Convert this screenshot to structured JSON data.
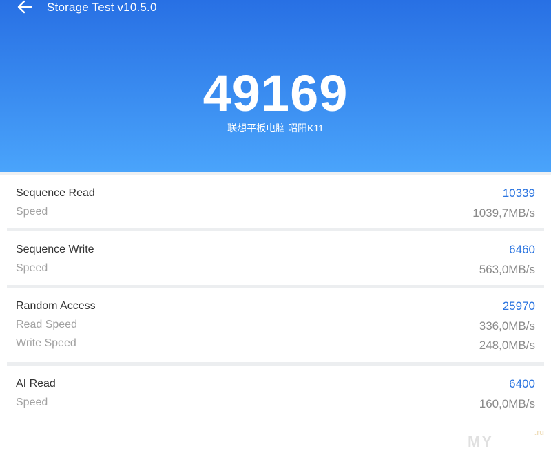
{
  "header": {
    "back_icon": "arrow-left-icon",
    "title": "Storage Test v10.5.0",
    "total_score": "49169",
    "device": "联想平板电脑 昭阳K11"
  },
  "results": [
    {
      "name": "Sequence Read",
      "score": "10339",
      "metrics": [
        {
          "label": "Speed",
          "value": "1039,7MB/s"
        }
      ]
    },
    {
      "name": "Sequence Write",
      "score": "6460",
      "metrics": [
        {
          "label": "Speed",
          "value": "563,0MB/s"
        }
      ]
    },
    {
      "name": "Random Access",
      "score": "25970",
      "metrics": [
        {
          "label": "Read Speed",
          "value": "336,0MB/s"
        },
        {
          "label": "Write Speed",
          "value": "248,0MB/s"
        }
      ]
    },
    {
      "name": "AI Read",
      "score": "6400",
      "metrics": [
        {
          "label": "Speed",
          "value": "160,0MB/s"
        }
      ]
    }
  ],
  "watermark": {
    "text": "MY",
    "sup": ".ru"
  },
  "colors": {
    "header_top": "#2870e4",
    "header_bottom": "#4aa4fb",
    "score_accent": "#2a74e0",
    "label_gray": "#a2a2a2",
    "value_gray": "#8a8a8a"
  }
}
